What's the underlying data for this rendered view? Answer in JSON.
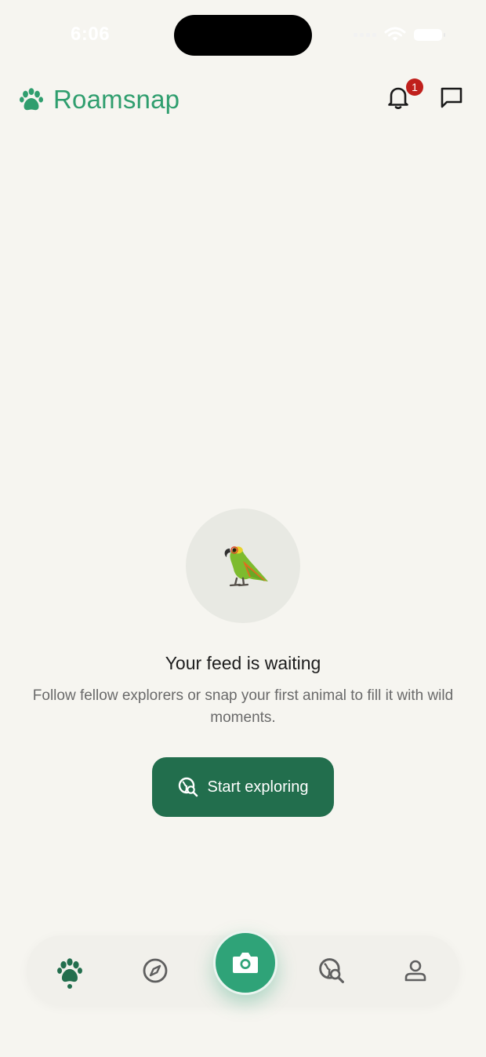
{
  "status_bar": {
    "time": "6:06"
  },
  "header": {
    "brand_name": "Roamsnap",
    "notification_count": "1"
  },
  "empty_state": {
    "title": "Your feed is waiting",
    "description": "Follow fellow explorers or snap your first animal to fill it with wild moments.",
    "cta_label": "Start exploring"
  },
  "tabs": [
    {
      "icon": "paw-icon",
      "active": true
    },
    {
      "icon": "compass-icon",
      "active": false
    },
    {
      "icon": "camera-icon",
      "active": false
    },
    {
      "icon": "globe-search-icon",
      "active": false
    },
    {
      "icon": "profile-icon",
      "active": false
    }
  ],
  "colors": {
    "brand": "#2f9e6e",
    "primary_button": "#226e4d",
    "camera_button": "#2fa378",
    "badge": "#c0201c",
    "background": "#f6f5f0"
  }
}
